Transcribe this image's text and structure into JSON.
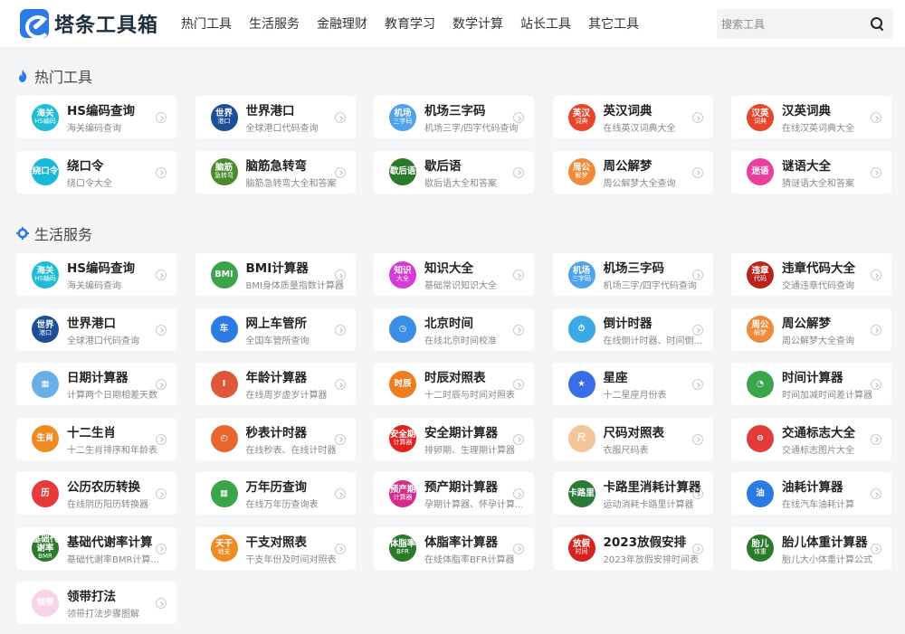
{
  "brand": {
    "name": "塔条工具箱",
    "logo_icon": "wrench-logo-icon",
    "color": "#2c7be5"
  },
  "nav": [
    "热门工具",
    "生活服务",
    "金融理财",
    "教育学习",
    "数学计算",
    "站长工具",
    "其它工具"
  ],
  "search": {
    "placeholder": "搜索工具",
    "icon": "search-icon"
  },
  "sections": [
    {
      "title": "热门工具",
      "icon": "flame-icon",
      "icon_color": "#2c7be5",
      "tools": [
        {
          "title": "HS编码查询",
          "desc": "海关编码查询",
          "badge": [
            "海关",
            "HS编码"
          ],
          "color": "#1ebcd6"
        },
        {
          "title": "世界港口",
          "desc": "全球港口代码查询",
          "badge": [
            "世界",
            "港口"
          ],
          "color": "#1f4e99"
        },
        {
          "title": "机场三字码",
          "desc": "机场三字/四字代码查询",
          "badge": [
            "机场",
            "三字码"
          ],
          "color": "#4fa3ea"
        },
        {
          "title": "英汉词典",
          "desc": "在线英汉词典大全",
          "badge": [
            "英汉",
            "词典"
          ],
          "color": "#e8452c"
        },
        {
          "title": "汉英词典",
          "desc": "在线汉英词典大全",
          "badge": [
            "汉英",
            "词典"
          ],
          "color": "#e8452c"
        },
        {
          "title": "绕口令",
          "desc": "绕口令大全",
          "badge": [
            "绕口令",
            ""
          ],
          "color": "#19b8d8"
        },
        {
          "title": "脑筋急转弯",
          "desc": "脑筋急转弯大全和答案",
          "badge": [
            "脑筋",
            "急转弯"
          ],
          "color": "#4a8a2a"
        },
        {
          "title": "歇后语",
          "desc": "歇后语大全和答案",
          "badge": [
            "歇后语",
            ""
          ],
          "color": "#2a7a2a"
        },
        {
          "title": "周公解梦",
          "desc": "周公解梦大全查询",
          "badge": [
            "周公",
            "解梦"
          ],
          "color": "#ef8b3a"
        },
        {
          "title": "谜语大全",
          "desc": "猜谜语大全和答案",
          "badge": [
            "迷语",
            ""
          ],
          "color": "#ec3f9c"
        }
      ]
    },
    {
      "title": "生活服务",
      "icon": "gear-icon",
      "icon_color": "#2c7be5",
      "tools": [
        {
          "title": "HS编码查询",
          "desc": "海关编码查询",
          "badge": [
            "海关",
            "HS编码"
          ],
          "color": "#1ebcd6"
        },
        {
          "title": "BMI计算器",
          "desc": "BMI身体质量指数计算器",
          "badge": [
            "BMI",
            ""
          ],
          "color": "#3aa54a"
        },
        {
          "title": "知识大全",
          "desc": "基础常识知识大全",
          "badge": [
            "知识",
            "大全"
          ],
          "color": "#d63bd6"
        },
        {
          "title": "机场三字码",
          "desc": "机场三字/四字代码查询",
          "badge": [
            "机场",
            "三字码"
          ],
          "color": "#4fa3ea"
        },
        {
          "title": "违章代码大全",
          "desc": "交通违章代码查询",
          "badge": [
            "违章",
            "代码"
          ],
          "color": "#b8231e"
        },
        {
          "title": "世界港口",
          "desc": "全球港口代码查询",
          "badge": [
            "世界",
            "港口"
          ],
          "color": "#1f4e99"
        },
        {
          "title": "网上车管所",
          "desc": "全国车管所查询",
          "badge": [
            "车",
            ""
          ],
          "color": "#2c7be5"
        },
        {
          "title": "北京时间",
          "desc": "在线北京时间校准",
          "badge": [
            "◷",
            ""
          ],
          "color": "#3a8ee6"
        },
        {
          "title": "倒计时器",
          "desc": "在线倒计时器、时间倒...",
          "badge": [
            "⏱",
            ""
          ],
          "color": "#3aa9e6"
        },
        {
          "title": "周公解梦",
          "desc": "周公解梦大全查询",
          "badge": [
            "周公",
            "解梦"
          ],
          "color": "#ef8b3a"
        },
        {
          "title": "日期计算器",
          "desc": "计算两个日期相差天数",
          "badge": [
            "▦",
            ""
          ],
          "color": "#6aaee6"
        },
        {
          "title": "年龄计算器",
          "desc": "在线周岁虚岁计算器",
          "badge": [
            "Ⅰ",
            ""
          ],
          "color": "#e0563a"
        },
        {
          "title": "时辰对照表",
          "desc": "十二时辰与时间对照表",
          "badge": [
            "时辰",
            ""
          ],
          "color": "#ef7d22"
        },
        {
          "title": "星座",
          "desc": "十二星座月份表",
          "badge": [
            "★",
            ""
          ],
          "color": "#3a6ee6"
        },
        {
          "title": "时间计算器",
          "desc": "时间加减时间差计算器",
          "badge": [
            "◔",
            ""
          ],
          "color": "#3aa54a"
        },
        {
          "title": "十二生肖",
          "desc": "十二生肖排序和年龄表",
          "badge": [
            "生肖",
            ""
          ],
          "color": "#ef8b22"
        },
        {
          "title": "秒表计时器",
          "desc": "在线秒表、在线计时器",
          "badge": [
            "◴",
            ""
          ],
          "color": "#e8662c"
        },
        {
          "title": "安全期计算器",
          "desc": "排卵期、生理期计算器",
          "badge": [
            "安全期",
            "计算器"
          ],
          "color": "#e3211e"
        },
        {
          "title": "尺码对照表",
          "desc": "衣服尺码表",
          "badge": [
            "尺",
            ""
          ],
          "color": "#f2c59a"
        },
        {
          "title": "交通标志大全",
          "desc": "交通标志图片大全",
          "badge": [
            "⊖",
            ""
          ],
          "color": "#e33a3a"
        },
        {
          "title": "公历农历转换",
          "desc": "在线阴历阳历转换器",
          "badge": [
            "历",
            ""
          ],
          "color": "#e83a3a"
        },
        {
          "title": "万年历查询",
          "desc": "在线万年历查询表",
          "badge": [
            "▦",
            ""
          ],
          "color": "#3aa54a"
        },
        {
          "title": "预产期计算器",
          "desc": "孕期计算器、怀孕计算...",
          "badge": [
            "预产期",
            "计算器"
          ],
          "color": "#d62b8c"
        },
        {
          "title": "卡路里消耗计算器",
          "desc": "运动消耗卡路里计算器",
          "badge": [
            "卡路里",
            ""
          ],
          "color": "#2a7a3a"
        },
        {
          "title": "油耗计算器",
          "desc": "在线汽车油耗计算",
          "badge": [
            "油",
            ""
          ],
          "color": "#2c7be5"
        },
        {
          "title": "基础代谢率计算",
          "desc": "基础代谢率BMR计算...",
          "badge": [
            "基础代谢率",
            "BMR"
          ],
          "color": "#2a7a2a"
        },
        {
          "title": "干支对照表",
          "desc": "干支年份及时间对照表",
          "badge": [
            "天干",
            "地支"
          ],
          "color": "#f08a22"
        },
        {
          "title": "体脂率计算器",
          "desc": "在线体脂率BFR计算器",
          "badge": [
            "体脂率",
            "BFR"
          ],
          "color": "#2a7a2a"
        },
        {
          "title": "2023放假安排",
          "desc": "2023年放假安排时间表",
          "badge": [
            "放假",
            "时间"
          ],
          "color": "#d6231e"
        },
        {
          "title": "胎儿体重计算器",
          "desc": "胎儿大小体重计算公式",
          "badge": [
            "胎儿",
            "体重"
          ],
          "color": "#2a7a2a"
        },
        {
          "title": "领带打法",
          "desc": "领带打法步骤图解",
          "badge": [
            "领带",
            ""
          ],
          "color": "#f6d3e6"
        }
      ]
    }
  ]
}
